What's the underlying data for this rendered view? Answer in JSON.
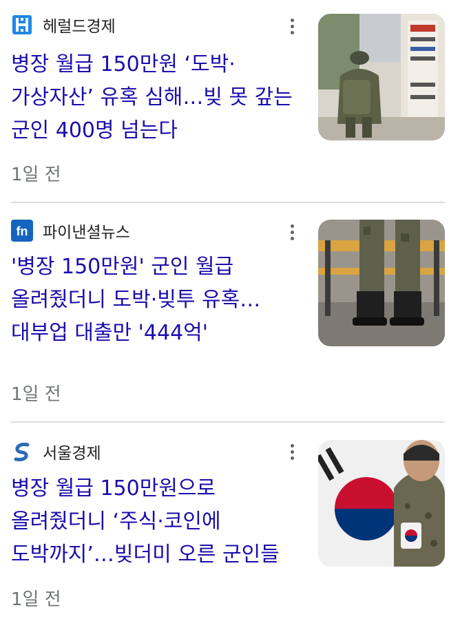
{
  "articles": [
    {
      "source": "헤럴드경제",
      "source_logo_icon": "herald-logo-icon",
      "headline": "병장 월급 150만원 ‘도박·가상자산’ 유혹 심해…빚 못 갚는 군인 400명 넘는다",
      "time": "1일 전",
      "thumbnail": "soldier-walking-street-photo"
    },
    {
      "source": "파이낸셜뉴스",
      "source_logo_icon": "fn-logo-icon",
      "headline": "'병장 150만원' 군인 월급 올려줬더니 도박·빚투 유혹…대부업 대출만 '444억'",
      "time": "1일 전",
      "thumbnail": "soldiers-boots-barrier-photo"
    },
    {
      "source": "서울경제",
      "source_logo_icon": "seoul-economic-logo-icon",
      "headline": "병장 월급 150만원으로 올려줬더니 ‘주식·코인에 도박까지’…빚더미 오른 군인들",
      "time": "1일 전",
      "thumbnail": "soldier-with-korean-flag-photo"
    }
  ],
  "colors": {
    "headline": "#1a0dab",
    "source_text": "#202124",
    "time_text": "#70757a",
    "divider": "#dadce0",
    "herald_logo": "#1e88e5",
    "fn_logo": "#1565c0",
    "seoul_logo": "#2d6bb5"
  }
}
